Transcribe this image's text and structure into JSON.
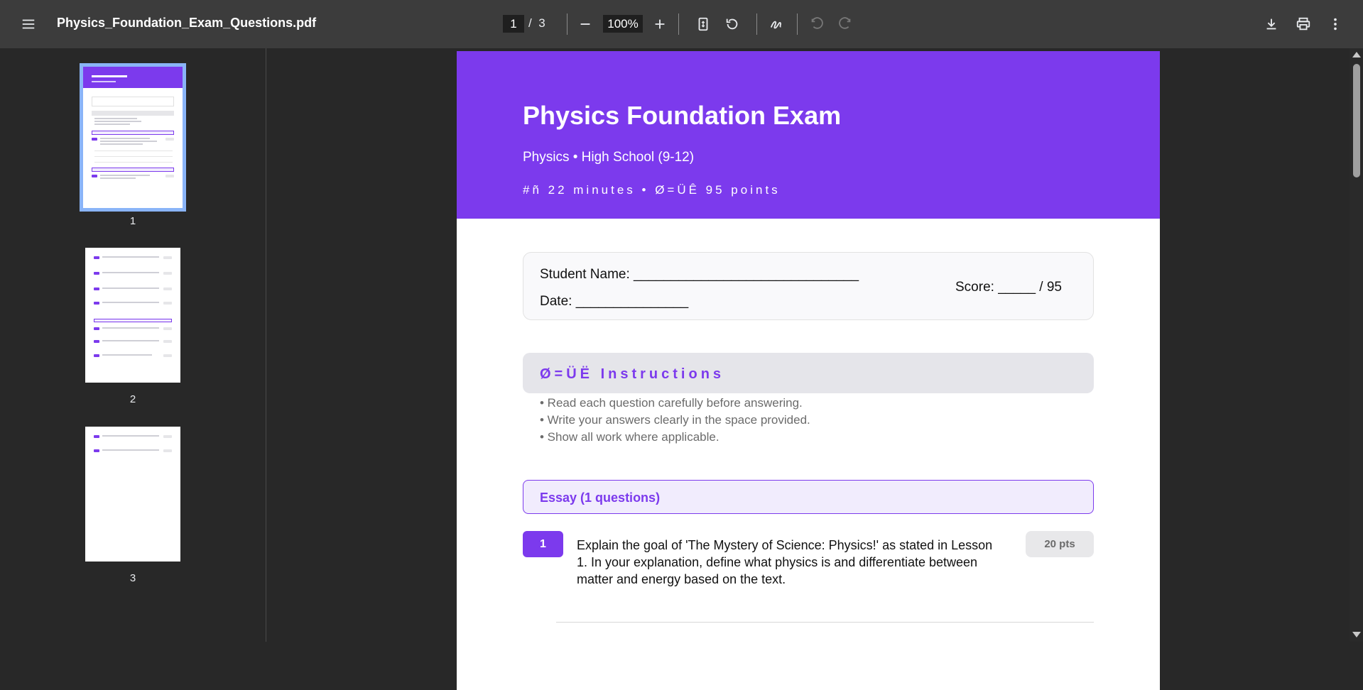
{
  "toolbar": {
    "file_name": "Physics_Foundation_Exam_Questions.pdf",
    "current_page": "1",
    "page_separator": "/",
    "total_pages": "3",
    "zoom": "100%"
  },
  "thumbnails": [
    {
      "label": "1",
      "selected": true
    },
    {
      "label": "2",
      "selected": false
    },
    {
      "label": "3",
      "selected": false
    }
  ],
  "document": {
    "title": "Physics Foundation Exam",
    "subtitle": "Physics  •  High School (9-12)",
    "meta": "#ñ 22 minutes  •  Ø=ÜÊ 95 points",
    "student_name_label": "Student Name: ______________________________",
    "date_label": "Date: _______________",
    "score_label": "Score: _____ / 95",
    "instructions_title": "Ø=ÜË  Instructions",
    "instructions": [
      "• Read each question carefully before answering.",
      "• Write your answers clearly in the space provided.",
      "• Show all work where applicable."
    ],
    "section_title": "Essay (1 questions)",
    "question": {
      "number": "1",
      "text": "Explain the goal of 'The Mystery of Science: Physics!' as stated in Lesson 1. In your explanation, define what physics is and differentiate between matter and energy based on the text.",
      "points": "20 pts"
    }
  },
  "colors": {
    "accent": "#7c3aed",
    "toolbar_bg": "#3c3c3c",
    "viewer_bg": "#282828",
    "thumb_selected": "#8ab4f8"
  }
}
